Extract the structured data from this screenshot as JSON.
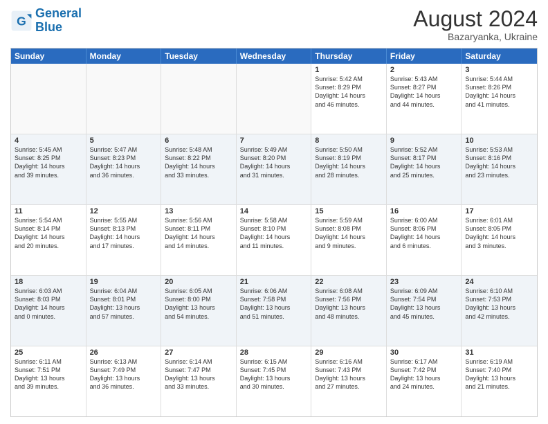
{
  "header": {
    "logo_general": "General",
    "logo_blue": "Blue",
    "title": "August 2024",
    "subtitle": "Bazaryanka, Ukraine"
  },
  "days": [
    "Sunday",
    "Monday",
    "Tuesday",
    "Wednesday",
    "Thursday",
    "Friday",
    "Saturday"
  ],
  "rows": [
    {
      "alt": false,
      "cells": [
        {
          "day": "",
          "content": ""
        },
        {
          "day": "",
          "content": ""
        },
        {
          "day": "",
          "content": ""
        },
        {
          "day": "",
          "content": ""
        },
        {
          "day": "1",
          "content": "Sunrise: 5:42 AM\nSunset: 8:29 PM\nDaylight: 14 hours\nand 46 minutes."
        },
        {
          "day": "2",
          "content": "Sunrise: 5:43 AM\nSunset: 8:27 PM\nDaylight: 14 hours\nand 44 minutes."
        },
        {
          "day": "3",
          "content": "Sunrise: 5:44 AM\nSunset: 8:26 PM\nDaylight: 14 hours\nand 41 minutes."
        }
      ]
    },
    {
      "alt": true,
      "cells": [
        {
          "day": "4",
          "content": "Sunrise: 5:45 AM\nSunset: 8:25 PM\nDaylight: 14 hours\nand 39 minutes."
        },
        {
          "day": "5",
          "content": "Sunrise: 5:47 AM\nSunset: 8:23 PM\nDaylight: 14 hours\nand 36 minutes."
        },
        {
          "day": "6",
          "content": "Sunrise: 5:48 AM\nSunset: 8:22 PM\nDaylight: 14 hours\nand 33 minutes."
        },
        {
          "day": "7",
          "content": "Sunrise: 5:49 AM\nSunset: 8:20 PM\nDaylight: 14 hours\nand 31 minutes."
        },
        {
          "day": "8",
          "content": "Sunrise: 5:50 AM\nSunset: 8:19 PM\nDaylight: 14 hours\nand 28 minutes."
        },
        {
          "day": "9",
          "content": "Sunrise: 5:52 AM\nSunset: 8:17 PM\nDaylight: 14 hours\nand 25 minutes."
        },
        {
          "day": "10",
          "content": "Sunrise: 5:53 AM\nSunset: 8:16 PM\nDaylight: 14 hours\nand 23 minutes."
        }
      ]
    },
    {
      "alt": false,
      "cells": [
        {
          "day": "11",
          "content": "Sunrise: 5:54 AM\nSunset: 8:14 PM\nDaylight: 14 hours\nand 20 minutes."
        },
        {
          "day": "12",
          "content": "Sunrise: 5:55 AM\nSunset: 8:13 PM\nDaylight: 14 hours\nand 17 minutes."
        },
        {
          "day": "13",
          "content": "Sunrise: 5:56 AM\nSunset: 8:11 PM\nDaylight: 14 hours\nand 14 minutes."
        },
        {
          "day": "14",
          "content": "Sunrise: 5:58 AM\nSunset: 8:10 PM\nDaylight: 14 hours\nand 11 minutes."
        },
        {
          "day": "15",
          "content": "Sunrise: 5:59 AM\nSunset: 8:08 PM\nDaylight: 14 hours\nand 9 minutes."
        },
        {
          "day": "16",
          "content": "Sunrise: 6:00 AM\nSunset: 8:06 PM\nDaylight: 14 hours\nand 6 minutes."
        },
        {
          "day": "17",
          "content": "Sunrise: 6:01 AM\nSunset: 8:05 PM\nDaylight: 14 hours\nand 3 minutes."
        }
      ]
    },
    {
      "alt": true,
      "cells": [
        {
          "day": "18",
          "content": "Sunrise: 6:03 AM\nSunset: 8:03 PM\nDaylight: 14 hours\nand 0 minutes."
        },
        {
          "day": "19",
          "content": "Sunrise: 6:04 AM\nSunset: 8:01 PM\nDaylight: 13 hours\nand 57 minutes."
        },
        {
          "day": "20",
          "content": "Sunrise: 6:05 AM\nSunset: 8:00 PM\nDaylight: 13 hours\nand 54 minutes."
        },
        {
          "day": "21",
          "content": "Sunrise: 6:06 AM\nSunset: 7:58 PM\nDaylight: 13 hours\nand 51 minutes."
        },
        {
          "day": "22",
          "content": "Sunrise: 6:08 AM\nSunset: 7:56 PM\nDaylight: 13 hours\nand 48 minutes."
        },
        {
          "day": "23",
          "content": "Sunrise: 6:09 AM\nSunset: 7:54 PM\nDaylight: 13 hours\nand 45 minutes."
        },
        {
          "day": "24",
          "content": "Sunrise: 6:10 AM\nSunset: 7:53 PM\nDaylight: 13 hours\nand 42 minutes."
        }
      ]
    },
    {
      "alt": false,
      "cells": [
        {
          "day": "25",
          "content": "Sunrise: 6:11 AM\nSunset: 7:51 PM\nDaylight: 13 hours\nand 39 minutes."
        },
        {
          "day": "26",
          "content": "Sunrise: 6:13 AM\nSunset: 7:49 PM\nDaylight: 13 hours\nand 36 minutes."
        },
        {
          "day": "27",
          "content": "Sunrise: 6:14 AM\nSunset: 7:47 PM\nDaylight: 13 hours\nand 33 minutes."
        },
        {
          "day": "28",
          "content": "Sunrise: 6:15 AM\nSunset: 7:45 PM\nDaylight: 13 hours\nand 30 minutes."
        },
        {
          "day": "29",
          "content": "Sunrise: 6:16 AM\nSunset: 7:43 PM\nDaylight: 13 hours\nand 27 minutes."
        },
        {
          "day": "30",
          "content": "Sunrise: 6:17 AM\nSunset: 7:42 PM\nDaylight: 13 hours\nand 24 minutes."
        },
        {
          "day": "31",
          "content": "Sunrise: 6:19 AM\nSunset: 7:40 PM\nDaylight: 13 hours\nand 21 minutes."
        }
      ]
    }
  ]
}
